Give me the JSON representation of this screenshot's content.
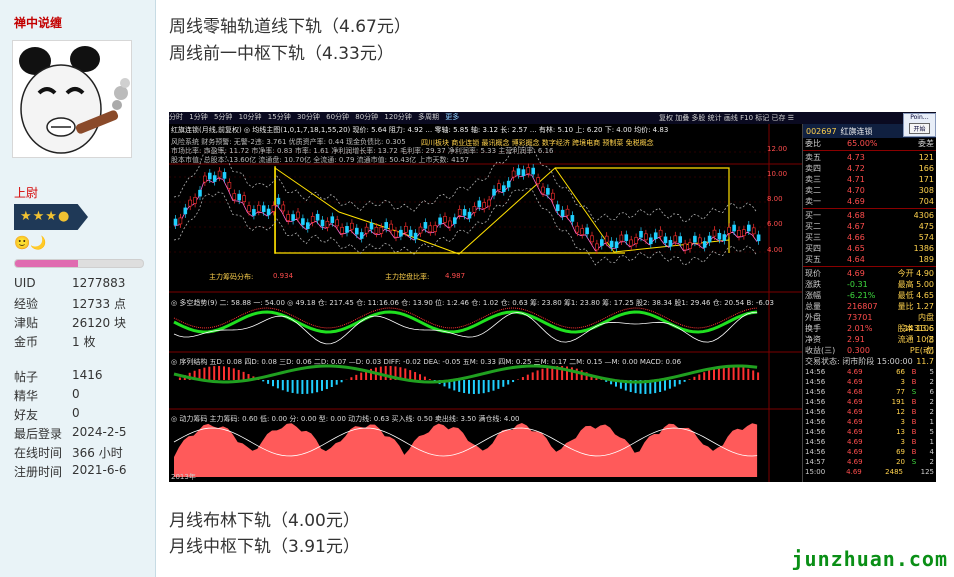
{
  "user": {
    "name": "禅中说缠",
    "rank": "上尉",
    "stars": "★★★●",
    "emotes": "🙂🌙",
    "progress": 0.49,
    "stats": [
      {
        "k": "UID",
        "v": "1277883"
      },
      {
        "k": "经验",
        "v": "12733 点"
      },
      {
        "k": "津贴",
        "v": "26120 块"
      },
      {
        "k": "金币",
        "v": "1 枚"
      }
    ],
    "stats2": [
      {
        "k": "帖子",
        "v": "1416"
      },
      {
        "k": "精华",
        "v": "0"
      },
      {
        "k": "好友",
        "v": "0"
      },
      {
        "k": "最后登录",
        "v": "2024-2-5"
      },
      {
        "k": "在线时间",
        "v": "366 小时"
      },
      {
        "k": "注册时间",
        "v": "2021-6-6"
      }
    ]
  },
  "post": {
    "lines_top": [
      "周线零轴轨道线下轨（4.67元）",
      "周线前一中枢下轨（4.33元）"
    ],
    "lines_bottom": [
      "月线布林下轨（4.00元）",
      "月线中枢下轨（3.91元）"
    ]
  },
  "chart": {
    "toolbar": [
      "分时",
      "1分钟",
      "5分钟",
      "10分钟",
      "15分钟",
      "30分钟",
      "60分钟",
      "80分钟",
      "120分钟",
      "多周期",
      "更多"
    ],
    "toolbar_right": "复权  加叠  多股  统计  画线  F10  标记  已存  ☰",
    "title_line": "红旗连锁(月线,前复权)  ◎ 均线主图(1,0,1,7,18,1,55,20)  现价: 5.64  阻力: 4.92  …  零轴: 5.85  轴: 3.12  长: 2.57  …  有林: 5.10  上: 6.20  下: 4.00  均价: 4.83",
    "info_lines": [
      "风险系统  财务预警: 无警-2违: 3.761  优质资产率: 0.44  现金负债比: 0.305",
      "市场比率: 市盈率: 11.72  市净率: 0.83  市率: 1.61  净利润增长率: 13.72  毛利率: 29.37  净利润率: 5.33  主营利润率: 6.16",
      "股本市值: 总股本: 13.60亿  流通盘: 10.70亿  全流通: 0.79  流通市值: 50.43亿  上市天数: 4157"
    ],
    "tag_row": "四川板块    商业连锁    最讯概念  博彩概念  数字经济  跨境电商  预制菜  免税概念",
    "ind1_label": "主力筹码分布:",
    "ind1_a": "0.934",
    "ind1_b_label": "主力控盘比率:",
    "ind1_b": "4.987",
    "sub1": "◎ 多空趋势(9)  二: 58.88  一: 54.00  ◎ 49.18  仓: 217.45  仓: 11:16.06  仓: 13.90  位: 1:2.46  仓: 1.02  仓: 0.63  筹: 23.80  筹1: 23.80  筹: 17.25  股2: 38.34  股1: 29.46  仓: 20.54  B: -6.03",
    "sub2": "◎ 序列结构  五D: 0.08  四D: 0.08  三D: 0.06  二D: 0.07  —D: 0.03  DIFF: -0.02  DEA: -0.05  五M: 0.33  四M: 0.25  三M: 0.17  二M: 0.15  —M: 0.00  MACD: 0.06",
    "sub3": "◎ 动力筹码  主力筹码: 0.60  低: 0.00  分: 0.00  型: 0.00  动力线: 0.63  买入线: 0.50  卖出线: 3.50  满仓线: 4.00",
    "price_ticks": [
      "12.00",
      "10.00",
      "8.00",
      "6.00",
      "4.00"
    ],
    "year_label": "2013年"
  },
  "quote": {
    "code": "002697",
    "name": "红旗连锁",
    "weibi_label": "委比",
    "weibi": "65.00%",
    "weicha_label": "委差",
    "sells": [
      {
        "a": "卖五",
        "b": "4.73",
        "c": "121"
      },
      {
        "a": "卖四",
        "b": "4.72",
        "c": "166"
      },
      {
        "a": "卖三",
        "b": "4.71",
        "c": "171"
      },
      {
        "a": "卖二",
        "b": "4.70",
        "c": "308"
      },
      {
        "a": "卖一",
        "b": "4.69",
        "c": "704"
      }
    ],
    "buys": [
      {
        "a": "买一",
        "b": "4.68",
        "c": "4306"
      },
      {
        "a": "买二",
        "b": "4.67",
        "c": "475"
      },
      {
        "a": "买三",
        "b": "4.66",
        "c": "574"
      },
      {
        "a": "买四",
        "b": "4.65",
        "c": "1386"
      },
      {
        "a": "买五",
        "b": "4.64",
        "c": "189"
      }
    ],
    "fields": [
      {
        "a": "现价",
        "b": "4.69",
        "c": "今开  4.90"
      },
      {
        "a": "涨跌",
        "b": "-0.31",
        "c": "最高  5.00"
      },
      {
        "a": "涨幅",
        "b": "-6.21%",
        "c": "最低  4.65"
      },
      {
        "a": "总量",
        "b": "216807",
        "c": "量比  1.27"
      },
      {
        "a": "外盘",
        "b": "73701",
        "c": "内盘  143106"
      },
      {
        "a": "换手",
        "b": "2.01%",
        "c": "股本  13.6亿"
      },
      {
        "a": "净资",
        "b": "2.91",
        "c": "流通  10.8亿"
      },
      {
        "a": "收益(三)",
        "b": "0.300",
        "c": "PE(动)  11.7"
      }
    ],
    "status": "交易状态: 闭市阶段 15:00:00",
    "trades": [
      {
        "t": "14:56",
        "p": "4.69",
        "v": "66",
        "s": "B",
        "n": "5"
      },
      {
        "t": "14:56",
        "p": "4.69",
        "v": "3",
        "s": "B",
        "n": "2"
      },
      {
        "t": "14:56",
        "p": "4.68",
        "v": "77",
        "s": "S",
        "n": "6"
      },
      {
        "t": "14:56",
        "p": "4.69",
        "v": "191",
        "s": "B",
        "n": "2"
      },
      {
        "t": "14:56",
        "p": "4.69",
        "v": "12",
        "s": "B",
        "n": "2"
      },
      {
        "t": "14:56",
        "p": "4.69",
        "v": "3",
        "s": "B",
        "n": "1"
      },
      {
        "t": "14:56",
        "p": "4.69",
        "v": "13",
        "s": "B",
        "n": "5"
      },
      {
        "t": "14:56",
        "p": "4.69",
        "v": "3",
        "s": "B",
        "n": "1"
      },
      {
        "t": "14:56",
        "p": "4.69",
        "v": "69",
        "s": "B",
        "n": "4"
      },
      {
        "t": "14:57",
        "p": "4.69",
        "v": "20",
        "s": "S",
        "n": "2"
      },
      {
        "t": "15:00",
        "p": "4.69",
        "v": "2485",
        "s": "",
        "n": "125"
      }
    ],
    "popup_title": "Poin…",
    "popup_btn": "开始"
  },
  "watermark": "junzhuan.com"
}
